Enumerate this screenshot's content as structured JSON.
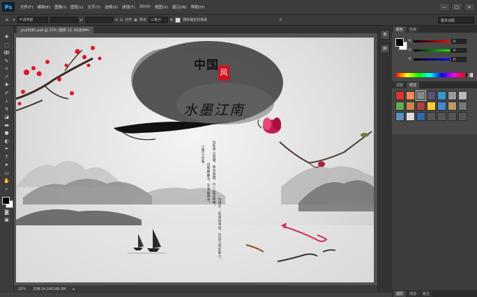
{
  "app": {
    "logo": "Ps"
  },
  "menu": [
    "文件(F)",
    "编辑(E)",
    "图像(I)",
    "图层(L)",
    "文字(Y)",
    "选择(S)",
    "滤镜(T)",
    "3D(D)",
    "视图(V)",
    "窗口(W)",
    "帮助(H)"
  ],
  "window_controls": [
    "—",
    "□",
    "✕"
  ],
  "options": {
    "style_value": "不透明度",
    "size_value": "",
    "width_value": "",
    "align_label": "对齐",
    "sample_label": "样本",
    "sample_value": "三等分",
    "delete_cropped_label": "删除裁剪的像素",
    "workspace": "基本功能"
  },
  "document": {
    "tab_title": "psd1681.psd @ 25% (图层 12, RGB/8#)",
    "zoom": "25%",
    "doc_info": "文档:34.1M/168.3M"
  },
  "artwork": {
    "title_top": "中国",
    "title_seal": "风",
    "subtitle": "水墨江南",
    "vertical_lines": [
      "江南三月春，",
      "白鹭翩翩水，平湖烟雨中，",
      "远处青山如黛，杏花春雨，行人是否断魂。",
      "古诗云：风景旧曾谙。日出江花红胜火，"
    ]
  },
  "panels": {
    "color_tabs": [
      "颜色",
      "色板"
    ],
    "adjust_tabs": [
      "调整",
      "样式"
    ],
    "bottom_tabs": [
      "图层",
      "通道",
      "路径"
    ],
    "rgb_labels": [
      "R",
      "G",
      "B"
    ],
    "rgb_values": [
      "0",
      "0",
      "0"
    ]
  },
  "colors": {
    "accent": "#5fb4f4",
    "canvas_bg": "#e6e6e6",
    "plum_blossom": "#e0142a",
    "magnolia": "#c9194e"
  }
}
